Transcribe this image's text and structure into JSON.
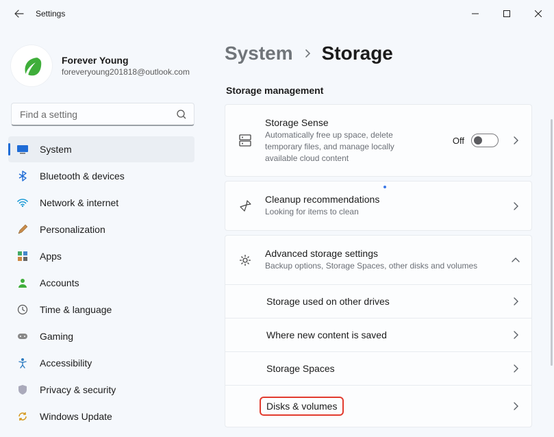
{
  "window": {
    "title": "Settings"
  },
  "profile": {
    "name": "Forever Young",
    "email": "foreveryoung201818@outlook.com"
  },
  "search": {
    "placeholder": "Find a setting"
  },
  "nav": {
    "items": [
      {
        "label": "System"
      },
      {
        "label": "Bluetooth & devices"
      },
      {
        "label": "Network & internet"
      },
      {
        "label": "Personalization"
      },
      {
        "label": "Apps"
      },
      {
        "label": "Accounts"
      },
      {
        "label": "Time & language"
      },
      {
        "label": "Gaming"
      },
      {
        "label": "Accessibility"
      },
      {
        "label": "Privacy & security"
      },
      {
        "label": "Windows Update"
      }
    ]
  },
  "breadcrumb": {
    "root": "System",
    "current": "Storage"
  },
  "section": {
    "title": "Storage management"
  },
  "cards": {
    "sense": {
      "title": "Storage Sense",
      "subtitle": "Automatically free up space, delete temporary files, and manage locally available cloud content",
      "toggle_label": "Off"
    },
    "cleanup": {
      "title": "Cleanup recommendations",
      "subtitle": "Looking for items to clean"
    },
    "advanced": {
      "title": "Advanced storage settings",
      "subtitle": "Backup options, Storage Spaces, other disks and volumes",
      "items": [
        {
          "label": "Storage used on other drives"
        },
        {
          "label": "Where new content is saved"
        },
        {
          "label": "Storage Spaces"
        },
        {
          "label": "Disks & volumes"
        }
      ]
    }
  }
}
